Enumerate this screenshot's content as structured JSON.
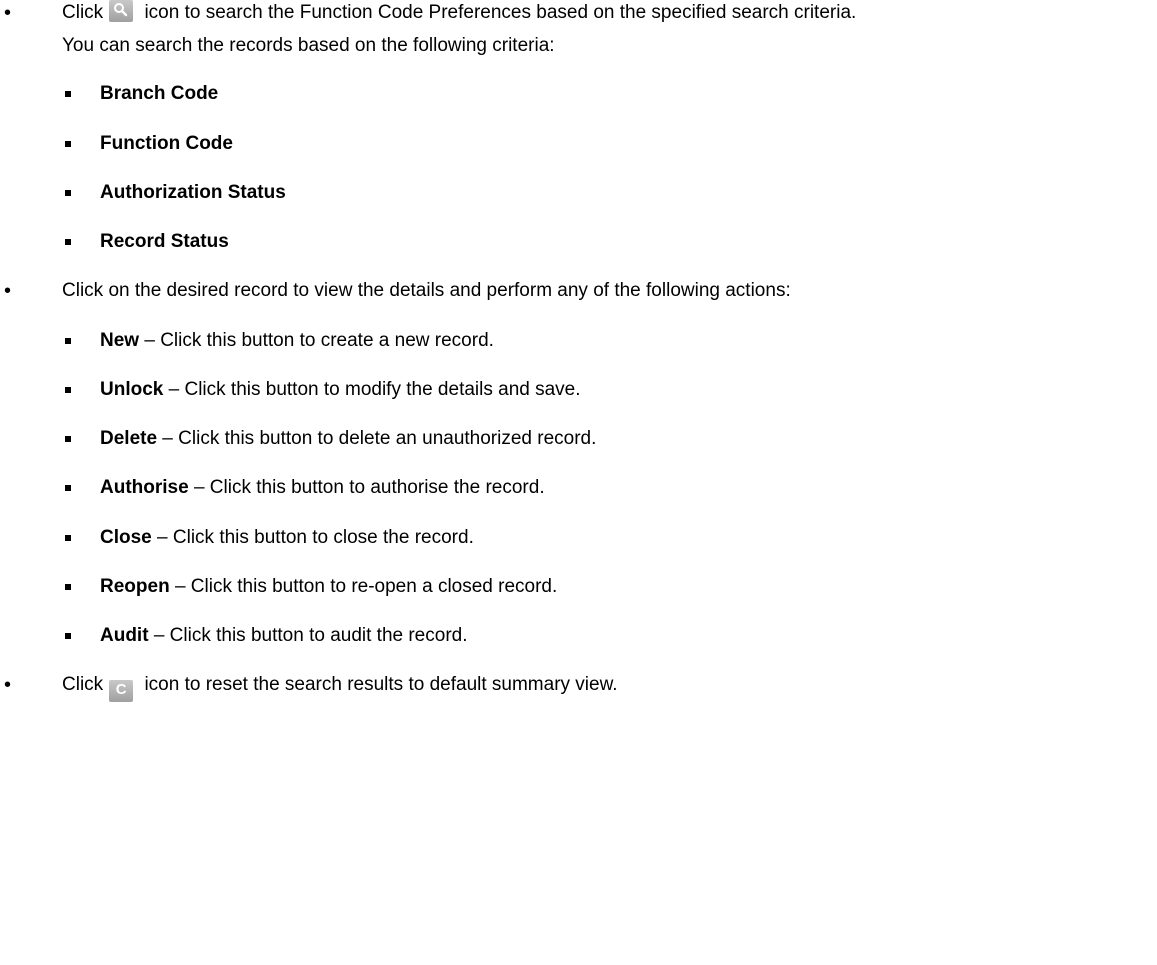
{
  "bullet1": {
    "prefix": "Click",
    "icon": "search-icon",
    "suffix": "icon to search the Function Code Preferences based on the specified search criteria.",
    "continuation": "You can search the records based on the following criteria:",
    "criteria": [
      "Branch Code",
      "Function Code",
      "Authorization Status",
      "Record Status"
    ]
  },
  "bullet2": {
    "text": "Click on the desired record to view the details and perform any of the following actions:",
    "actions": [
      {
        "name": "New",
        "desc": " – Click this button to create a new record."
      },
      {
        "name": "Unlock",
        "desc": " – Click this button to modify the details and save."
      },
      {
        "name": "Delete",
        "desc": " – Click this button to delete an unauthorized record."
      },
      {
        "name": "Authorise",
        "desc": " – Click this button to authorise the record."
      },
      {
        "name": "Close",
        "desc": " – Click this button to close the record."
      },
      {
        "name": "Reopen",
        "desc": " – Click this button to re-open a closed record."
      },
      {
        "name": "Audit",
        "desc": " – Click this button to audit the record."
      }
    ]
  },
  "bullet3": {
    "prefix": "Click",
    "icon": "reset-icon",
    "icon_glyph": "C",
    "suffix": "icon to reset the search results to default summary view."
  }
}
